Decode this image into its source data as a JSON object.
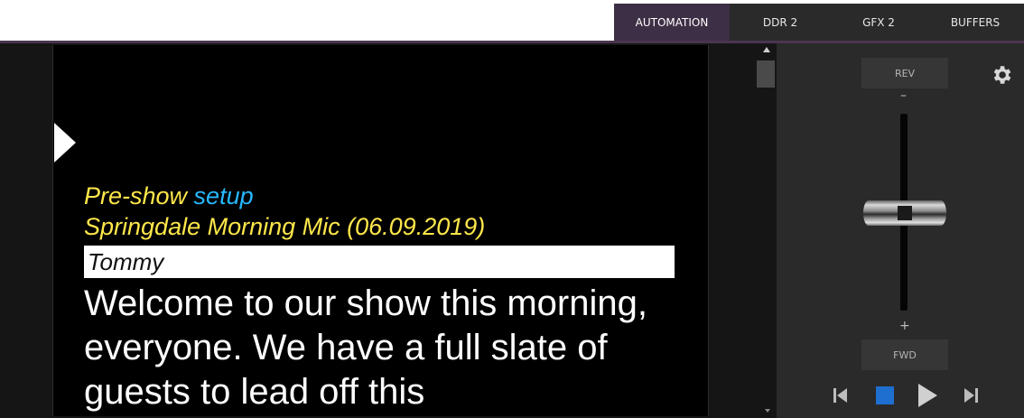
{
  "tabs": [
    {
      "label": "AUTOMATION",
      "active": true
    },
    {
      "label": "DDR 2",
      "active": false
    },
    {
      "label": "GFX 2",
      "active": false
    },
    {
      "label": "BUFFERS",
      "active": false
    }
  ],
  "script": {
    "line1_a": "Pre-show ",
    "line1_b": "setup",
    "line2": "Springdale Morning Mic (06.09.2019)",
    "speaker": "Tommy",
    "body": "Welcome to our show this morning, everyone.  We have a full slate of guests to lead off this"
  },
  "controls": {
    "rev_label": "REV",
    "fwd_label": "FWD",
    "minus": "–",
    "plus": "+",
    "speed_level": 0.5
  },
  "icons": {
    "settings": "gear-icon",
    "prev": "skip-back-icon",
    "stop": "stop-icon",
    "play": "play-icon",
    "next": "skip-forward-icon"
  },
  "colors": {
    "accent": "#3d2f45",
    "cue_yellow": "#ffe74a",
    "cue_blue": "#27b8ff",
    "stop_blue": "#1f6fd0"
  }
}
